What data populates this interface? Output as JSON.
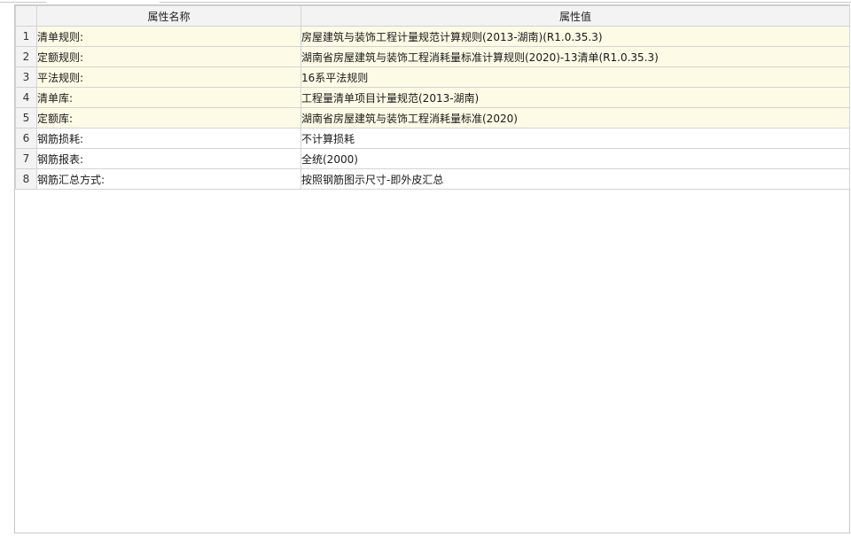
{
  "grid": {
    "columns": {
      "index": "",
      "name": "属性名称",
      "value": "属性值"
    },
    "rows": [
      {
        "index": "1",
        "name": "清单规则:",
        "value": "房屋建筑与装饰工程计量规范计算规则(2013-湖南)(R1.0.35.3)",
        "highlight": true
      },
      {
        "index": "2",
        "name": "定额规则:",
        "value": "湖南省房屋建筑与装饰工程消耗量标准计算规则(2020)-13清单(R1.0.35.3)",
        "highlight": true
      },
      {
        "index": "3",
        "name": "平法规则:",
        "value": "16系平法规则",
        "highlight": true
      },
      {
        "index": "4",
        "name": "清单库:",
        "value": "工程量清单项目计量规范(2013-湖南)",
        "highlight": true
      },
      {
        "index": "5",
        "name": "定额库:",
        "value": "湖南省房屋建筑与装饰工程消耗量标准(2020)",
        "highlight": true
      },
      {
        "index": "6",
        "name": "钢筋损耗:",
        "value": "不计算损耗",
        "highlight": false
      },
      {
        "index": "7",
        "name": "钢筋报表:",
        "value": "全统(2000)",
        "highlight": false
      },
      {
        "index": "8",
        "name": "钢筋汇总方式:",
        "value": "按照钢筋图示尺寸-即外皮汇总",
        "highlight": false
      }
    ]
  },
  "colors": {
    "highlight_row": "#fdfbe6",
    "header_bg": "#f3f3f3",
    "grid_line": "#d3d3d3"
  }
}
